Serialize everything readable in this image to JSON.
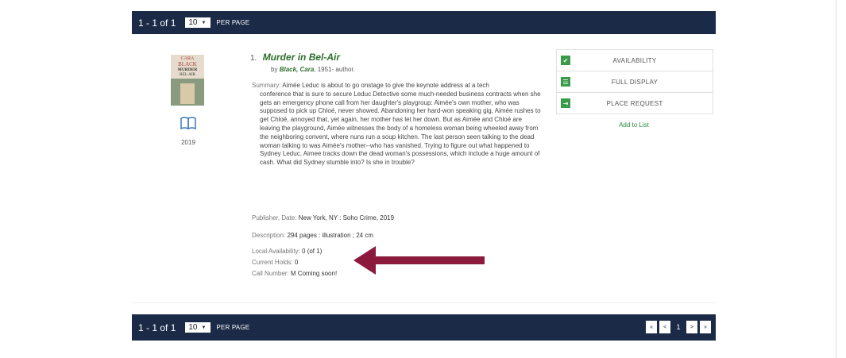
{
  "results_bar_top": {
    "count": "1 - 1 of 1",
    "per_page_value": "10",
    "per_page_label": "PER PAGE"
  },
  "results_bar_bottom": {
    "count": "1 - 1 of 1",
    "per_page_value": "10",
    "per_page_label": "PER PAGE",
    "pager": {
      "first": "«",
      "prev": "<",
      "current": "1",
      "next": ">",
      "last": "»"
    }
  },
  "record": {
    "number": "1.",
    "title": "Murder in Bel-Air",
    "by": "by",
    "author": "Black, Cara",
    "author_dates": ", 1951- author.",
    "cover_text": {
      "line1": "CARA",
      "line2": "BLACK",
      "line3": "MURDER",
      "line4": "BEL-AIR"
    },
    "format_icon": "book-icon",
    "year": "2019",
    "summary_label": "Summary:",
    "summary_first": "Aimée Leduc is about to go onstage to give the keynote address at a tech",
    "summary_rest": "conference that is sure to secure Leduc Detective some much-needed business contracts when she gets an emergency phone call from her daughter's playgroup: Aimée's own mother, who was supposed to pick up Chloé, never showed. Abandoning her hard-won speaking gig, Aimée rushes to get Chloé, annoyed that, yet again, her mother has let her down. But as Aimée and Chloé are leaving the playground, Aimée witnesses the body of a homeless woman being wheeled away from the neighboring convent, where nuns run a soup kitchen. The last person seen talking to the dead woman talking to was Aimée's mother--who has vanished. Trying to figure out what happened to Sydney Leduc, Aimee tracks down the dead woman's possessions, which include a huge amount of cash. What did Sydney stumble into? Is she in trouble?",
    "publisher_label": "Publisher, Date:",
    "publisher_value": "New York, NY : Soho Crime, 2019",
    "description_label": "Description:",
    "description_value": "294 pages : illustration ; 24 cm",
    "local_availability_label": "Local Availability:",
    "local_availability_value": "0 (of 1)",
    "current_holds_label": "Current Holds:",
    "current_holds_value": "0",
    "call_number_label": "Call Number:",
    "call_number_value": "M Coming soon!"
  },
  "actions": {
    "availability": {
      "label": "AVAILABILITY",
      "icon": "check-icon"
    },
    "full_display": {
      "label": "FULL DISPLAY",
      "icon": "list-icon"
    },
    "place_request": {
      "label": "PLACE REQUEST",
      "icon": "sign-in-icon"
    },
    "add_to_list": "Add to List"
  },
  "colors": {
    "nav_bar": "#1b2a47",
    "accent_green": "#3a9a4a",
    "title_green": "#2b6e2b",
    "arrow": "#8b1a3d"
  }
}
